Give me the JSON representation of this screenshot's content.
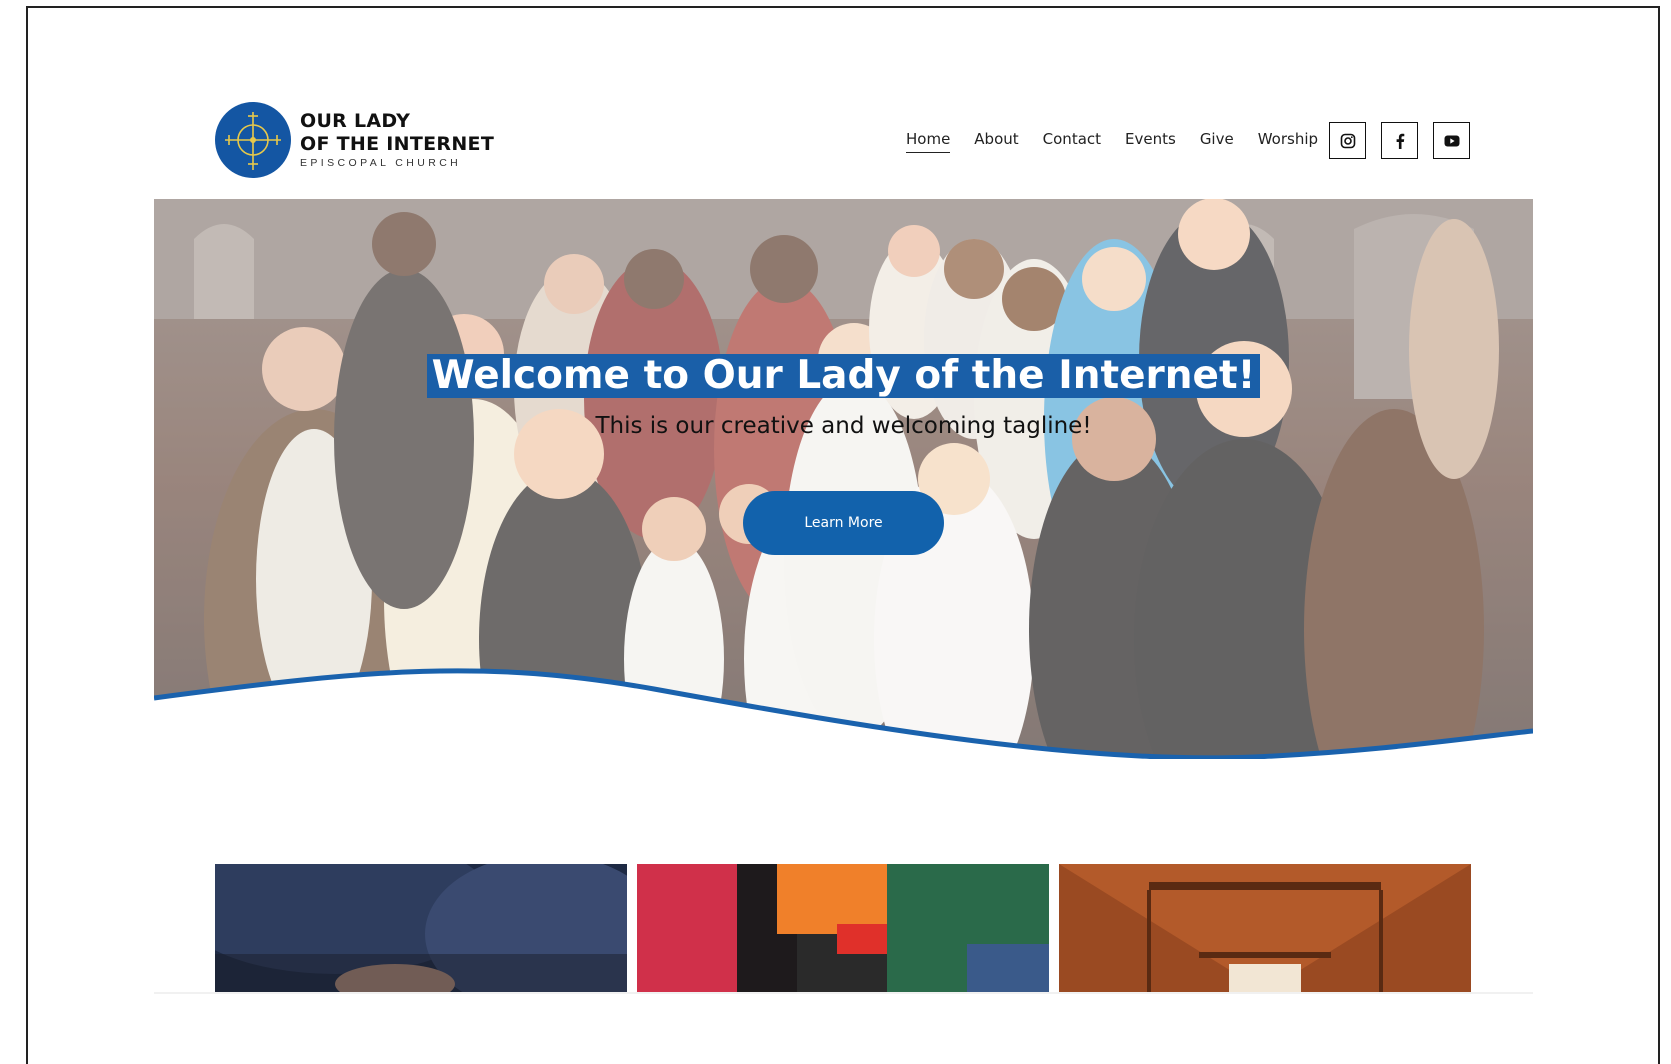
{
  "site": {
    "logo": {
      "line1": "OUR LADY",
      "line2": "OF THE INTERNET",
      "line3": "EPISCOPAL CHURCH"
    },
    "nav": {
      "items": [
        {
          "label": "Home",
          "active": true
        },
        {
          "label": "About"
        },
        {
          "label": "Contact"
        },
        {
          "label": "Events"
        },
        {
          "label": "Give"
        },
        {
          "label": "Worship"
        }
      ]
    },
    "social": [
      "instagram-icon",
      "facebook-icon",
      "youtube-icon"
    ]
  },
  "hero": {
    "title": "Welcome to Our Lady of the Internet!",
    "tagline": "This is our creative and welcoming tagline!",
    "button_label": "Learn More"
  },
  "colors": {
    "brand_blue": "#1456a3",
    "button_blue": "#1262ac",
    "wave_blue": "#1a62ad"
  }
}
